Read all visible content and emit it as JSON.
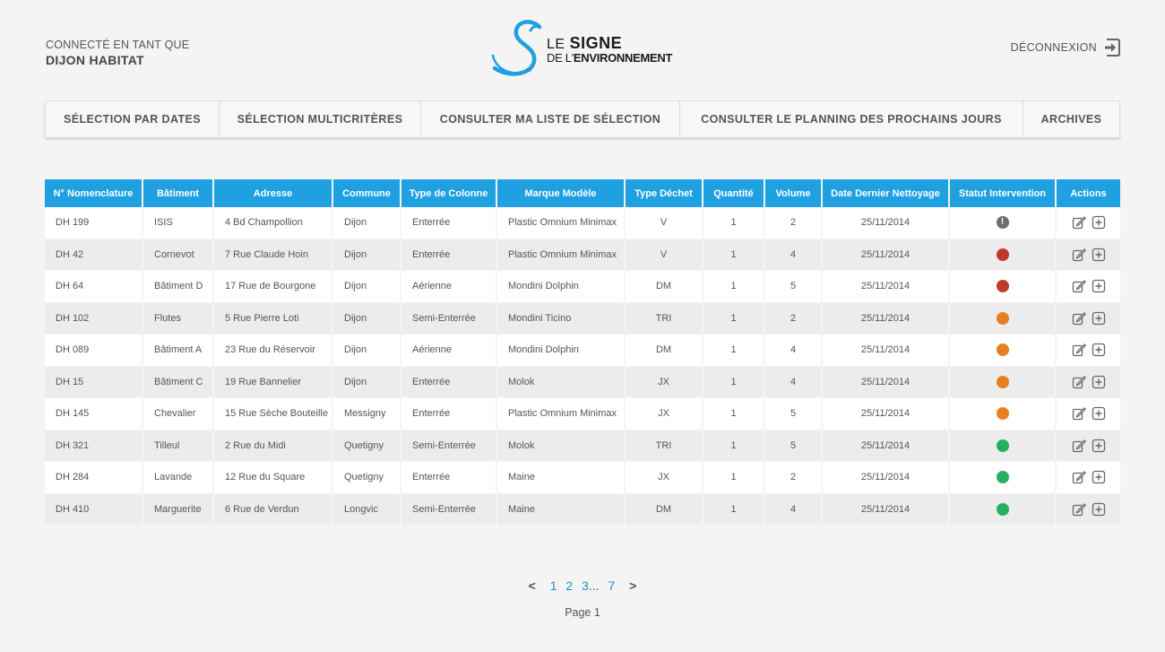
{
  "user": {
    "label": "CONNECTÉ EN TANT QUE",
    "name": "DIJON HABITAT"
  },
  "logo": {
    "line1_a": "LE",
    "line1_b": "SIGNE",
    "line2_a": "DE L'",
    "line2_b": "ENVIRONNEMENT"
  },
  "logout": {
    "label": "DÉCONNEXION",
    "icon": "logout-icon"
  },
  "nav": [
    {
      "label": "SÉLECTION PAR DATES"
    },
    {
      "label": "SÉLECTION MULTICRITÈRES"
    },
    {
      "label": "CONSULTER MA LISTE DE SÉLECTION"
    },
    {
      "label": "CONSULTER LE PLANNING DES PROCHAINS JOURS"
    },
    {
      "label": "ARCHIVES"
    }
  ],
  "table": {
    "headers": [
      "N° Nomenclature",
      "Bâtiment",
      "Adresse",
      "Commune",
      "Type de Colonne",
      "Marque Modèle",
      "Type Déchet",
      "Quantité",
      "Volume",
      "Date Dernier Nettoyage",
      "Statut Intervention",
      "Actions"
    ],
    "rows": [
      {
        "nomenclature": "DH 199",
        "batiment": "ISIS",
        "adresse": "4 Bd Champollion",
        "commune": "Dijon",
        "type_colonne": "Enterrée",
        "marque": "Plastic Omnium Minimax",
        "type_dechet": "V",
        "quantite": "1",
        "volume": "2",
        "date": "25/11/2014",
        "status": "warning"
      },
      {
        "nomenclature": "DH 42",
        "batiment": "Cornevot",
        "adresse": "7 Rue Claude Hoin",
        "commune": "Dijon",
        "type_colonne": "Enterrée",
        "marque": "Plastic Omnium Minimax",
        "type_dechet": "V",
        "quantite": "1",
        "volume": "4",
        "date": "25/11/2014",
        "status": "red"
      },
      {
        "nomenclature": "DH 64",
        "batiment": "Bâtiment D",
        "adresse": "17 Rue de Bourgone",
        "commune": "Dijon",
        "type_colonne": "Aérienne",
        "marque": "Mondini Dolphin",
        "type_dechet": "DM",
        "quantite": "1",
        "volume": "5",
        "date": "25/11/2014",
        "status": "red"
      },
      {
        "nomenclature": "DH 102",
        "batiment": "Flutes",
        "adresse": "5 Rue Pierre Loti",
        "commune": "Dijon",
        "type_colonne": "Semi-Enterrée",
        "marque": "Mondini Ticino",
        "type_dechet": "TRI",
        "quantite": "1",
        "volume": "2",
        "date": "25/11/2014",
        "status": "orange"
      },
      {
        "nomenclature": "DH 089",
        "batiment": "Bâtiment A",
        "adresse": "23 Rue du Réservoir",
        "commune": "Dijon",
        "type_colonne": "Aérienne",
        "marque": "Mondini Dolphin",
        "type_dechet": "DM",
        "quantite": "1",
        "volume": "4",
        "date": "25/11/2014",
        "status": "orange"
      },
      {
        "nomenclature": "DH 15",
        "batiment": "Bâtiment C",
        "adresse": "19 Rue Bannelier",
        "commune": "Dijon",
        "type_colonne": "Enterrée",
        "marque": "Molok",
        "type_dechet": "JX",
        "quantite": "1",
        "volume": "4",
        "date": "25/11/2014",
        "status": "orange"
      },
      {
        "nomenclature": "DH 145",
        "batiment": "Chevalier",
        "adresse": "15 Rue Sèche Bouteille",
        "commune": "Messigny",
        "type_colonne": "Enterrée",
        "marque": "Plastic Omnium Minimax",
        "type_dechet": "JX",
        "quantite": "1",
        "volume": "5",
        "date": "25/11/2014",
        "status": "orange"
      },
      {
        "nomenclature": "DH 321",
        "batiment": "Tilleul",
        "adresse": "2 Rue du Midi",
        "commune": "Quetigny",
        "type_colonne": "Semi-Enterrée",
        "marque": "Molok",
        "type_dechet": "TRI",
        "quantite": "1",
        "volume": "5",
        "date": "25/11/2014",
        "status": "green"
      },
      {
        "nomenclature": "DH 284",
        "batiment": "Lavande",
        "adresse": "12 Rue du Square",
        "commune": "Quetigny",
        "type_colonne": "Enterrée",
        "marque": "Maine",
        "type_dechet": "JX",
        "quantite": "1",
        "volume": "2",
        "date": "25/11/2014",
        "status": "green"
      },
      {
        "nomenclature": "DH 410",
        "batiment": "Marguerite",
        "adresse": "6 Rue de Verdun",
        "commune": "Longvic",
        "type_colonne": "Semi-Enterrée",
        "marque": "Maine",
        "type_dechet": "DM",
        "quantite": "1",
        "volume": "4",
        "date": "25/11/2014",
        "status": "green"
      }
    ],
    "status_colors": {
      "red": "#c0392b",
      "orange": "#e67e22",
      "green": "#27ae60",
      "warning": "#6d6d6d"
    },
    "action_icons": [
      "edit-icon",
      "add-square-icon"
    ]
  },
  "pagination": {
    "prev": "<",
    "pages": [
      "1",
      "2",
      "3"
    ],
    "ellipsis": "...",
    "last": "7",
    "next": ">",
    "label": "Page 1"
  },
  "colors": {
    "accent": "#1fa0e0",
    "link": "#1a8fd1",
    "background": "#f4f4f4"
  }
}
